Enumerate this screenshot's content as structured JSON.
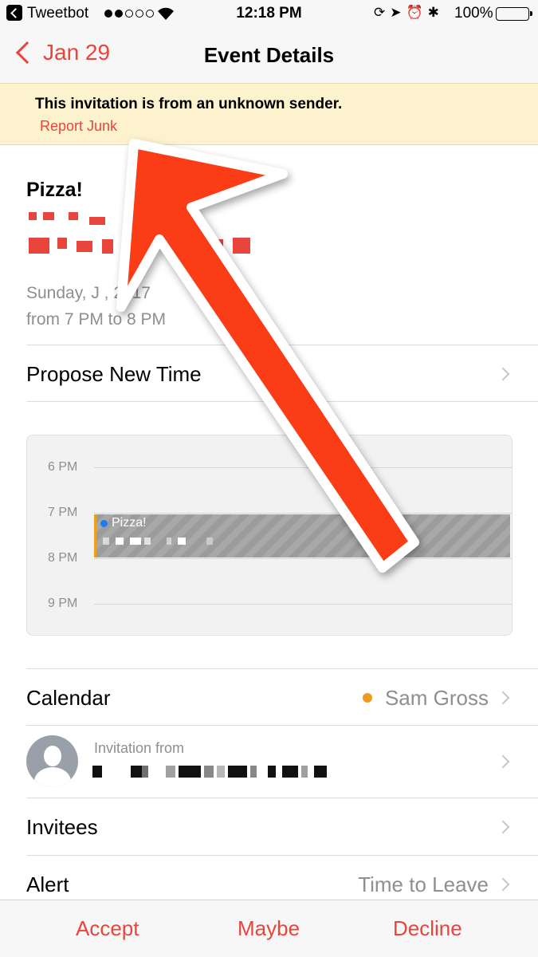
{
  "status_bar": {
    "back_app": "Tweetbot",
    "time": "12:18 PM",
    "battery": "100%",
    "icons": [
      "back-app-icon",
      "signal-icon",
      "wifi-icon",
      "screen-lock-icon",
      "location-icon",
      "alarm-icon",
      "bluetooth-icon",
      "battery-icon"
    ],
    "signal_bars_filled": 2,
    "signal_bars_total": 5
  },
  "nav": {
    "back_label": "Jan 29",
    "title": "Event Details"
  },
  "banner": {
    "message": "This invitation is from an unknown sender.",
    "action": "Report Junk"
  },
  "event": {
    "title": "Pizza!",
    "date": "Sunday, J    , 2017",
    "time": "from 7 PM to 8 PM"
  },
  "propose": {
    "label": "Propose New Time"
  },
  "day_preview": {
    "hours": [
      "6 PM",
      "7 PM",
      "8 PM",
      "9 PM"
    ],
    "event_name": "Pizza!"
  },
  "details": {
    "calendar_label": "Calendar",
    "calendar_value": "Sam Gross",
    "invitation_label": "Invitation from",
    "invitees_label": "Invitees",
    "alert_label": "Alert",
    "alert_value": "Time to Leave"
  },
  "actions": {
    "accept": "Accept",
    "maybe": "Maybe",
    "decline": "Decline"
  },
  "colors": {
    "accent": "#e8453c",
    "banner_bg": "#fcf2ce",
    "arrow": "#fa3d16",
    "calendar_dot": "#f09a20"
  }
}
